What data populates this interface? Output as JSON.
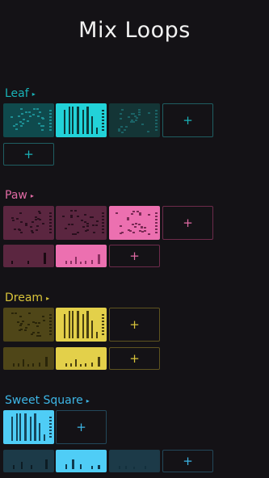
{
  "header": {
    "title": "Mix Loops"
  },
  "sections": [
    {
      "id": "leaf",
      "name": "Leaf",
      "color": "#19b3b8",
      "dim": "#0f4a4d",
      "bright": "#22d2d8",
      "line": "#1f5e62"
    },
    {
      "id": "paw",
      "name": "Paw",
      "color": "#e06aa4",
      "dim": "#5b2640",
      "bright": "#ec70b0",
      "line": "#6d2b4b"
    },
    {
      "id": "dream",
      "name": "Dream",
      "color": "#d8c33a",
      "dim": "#4f4618",
      "bright": "#e3d04a",
      "line": "#5e5320"
    },
    {
      "id": "sweet-square",
      "name": "Sweet Square",
      "color": "#3db6e6",
      "dim": "#1c3a48",
      "bright": "#4fcdf6",
      "line": "#23485a"
    }
  ],
  "add_label": "+",
  "arrow_glyph": "▸"
}
